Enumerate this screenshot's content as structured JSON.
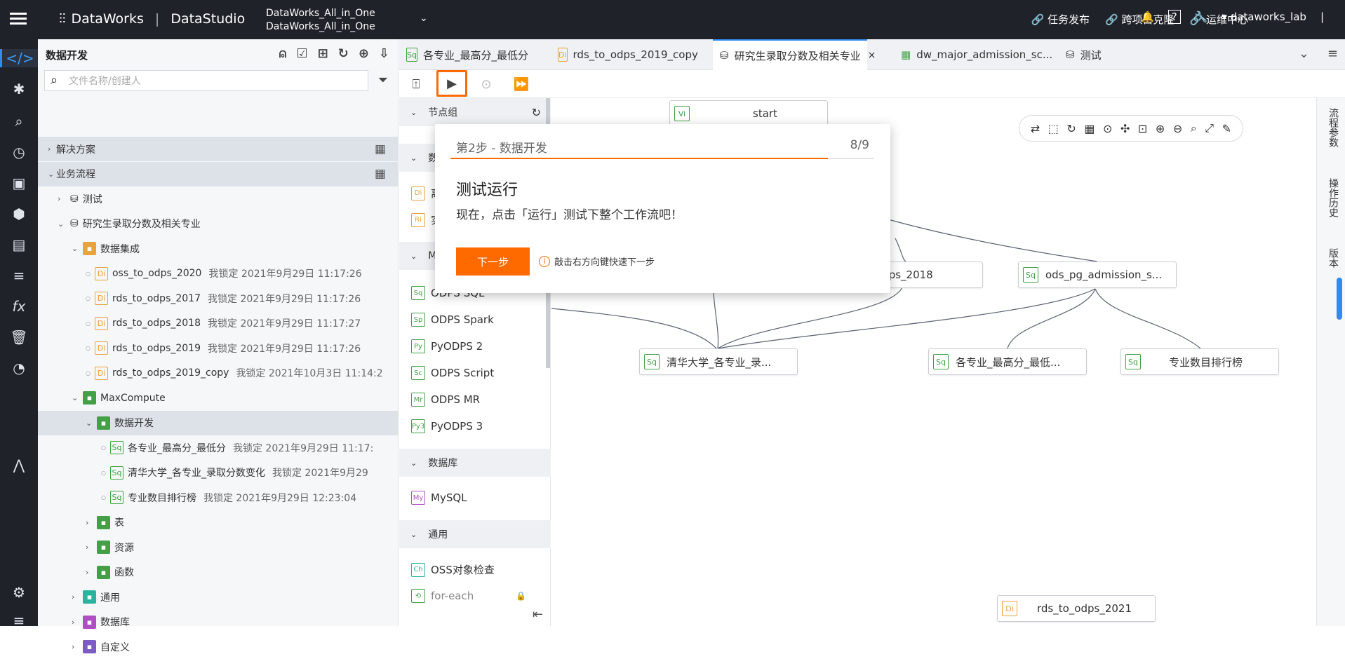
{
  "topbar": {
    "product": "DataWorks",
    "module": "DataStudio",
    "workspace_line1": "DataWorks_All_in_One",
    "workspace_line2": "DataWorks_All_in_One",
    "links": [
      "任务发布",
      "跨项目克隆",
      "运维中心"
    ],
    "help": "?",
    "user": "dataworks_lab"
  },
  "sidebar": {
    "title": "数据开发",
    "search_placeholder": "文件名称/创建人",
    "tree": [
      {
        "label": "解决方案",
        "level": 0,
        "caret": "›",
        "grid": true
      },
      {
        "label": "业务流程",
        "level": 0,
        "caret": "⌄",
        "grid": true
      },
      {
        "label": "测试",
        "level": 1,
        "caret": "›"
      },
      {
        "label": "研究生录取分数及相关专业",
        "level": 1,
        "caret": "⌄"
      },
      {
        "label": "数据集成",
        "level": 2,
        "caret": "⌄"
      },
      {
        "label": "oss_to_odps_2020",
        "meta": "我锁定  2021年9月29日 11:17:26",
        "level": 3,
        "icon": "Di"
      },
      {
        "label": "rds_to_odps_2017",
        "meta": "我锁定  2021年9月29日 11:17:26",
        "level": 3,
        "icon": "Di"
      },
      {
        "label": "rds_to_odps_2018",
        "meta": "我锁定  2021年9月29日 11:17:27",
        "level": 3,
        "icon": "Di"
      },
      {
        "label": "rds_to_odps_2019",
        "meta": "我锁定  2021年9月29日 11:17:26",
        "level": 3,
        "icon": "Di"
      },
      {
        "label": "rds_to_odps_2019_copy",
        "meta": "我锁定  2021年10月3日 11:14:2",
        "level": 3,
        "icon": "Di"
      },
      {
        "label": "MaxCompute",
        "level": 2,
        "caret": "⌄"
      },
      {
        "label": "数据开发",
        "level": 3,
        "caret": "⌄"
      },
      {
        "label": "各专业_最高分_最低分",
        "meta": "我锁定  2021年9月29日 11:17:",
        "level": 4,
        "icon": "Sq"
      },
      {
        "label": "清华大学_各专业_录取分数变化",
        "meta": "我锁定  2021年9月29",
        "level": 4,
        "icon": "Sq"
      },
      {
        "label": "专业数目排行榜",
        "meta": "我锁定  2021年9月29日 12:23:04",
        "level": 4,
        "icon": "Sq"
      },
      {
        "label": "表",
        "level": 3,
        "caret": "›"
      },
      {
        "label": "资源",
        "level": 3,
        "caret": "›"
      },
      {
        "label": "函数",
        "level": 3,
        "caret": "›"
      },
      {
        "label": "通用",
        "level": 2,
        "caret": "›"
      },
      {
        "label": "数据库",
        "level": 2,
        "caret": "›"
      },
      {
        "label": "自定义",
        "level": 2,
        "caret": "›"
      }
    ]
  },
  "tabs": [
    {
      "label": "各专业_最高分_最低分",
      "icon": "Sq"
    },
    {
      "label": "rds_to_odps_2019_copy",
      "icon": "Di"
    },
    {
      "label": "研究生录取分数及相关专业",
      "icon": "flow",
      "close": "×"
    },
    {
      "label": "dw_major_admission_sc...",
      "icon": "table"
    },
    {
      "label": "测试",
      "icon": "flow"
    }
  ],
  "node_panel": {
    "sections": [
      "节点组",
      "数",
      "M",
      "数据库",
      "通用"
    ],
    "maxcompute_nodes": [
      "ODPS SQL",
      "ODPS Spark",
      "PyODPS 2",
      "ODPS Script",
      "ODPS MR",
      "PyODPS 3"
    ],
    "maxcompute_icons": [
      "Sq",
      "Sp",
      "Py",
      "Sc",
      "Mr",
      "Py3"
    ],
    "db_nodes": [
      "MySQL"
    ],
    "general_nodes": [
      "OSS对象检查",
      "for-each"
    ],
    "partial_labels": [
      "离",
      "实"
    ],
    "partial_icons": [
      "Di",
      "Ri"
    ]
  },
  "canvas": {
    "nodes": [
      {
        "label": "start",
        "icon": "Vi"
      },
      {
        "label": "odps_2018",
        "icon": ""
      },
      {
        "label": "ods_pg_admission_s...",
        "icon": "Sq"
      },
      {
        "label": "清华大学_各专业_录...",
        "icon": "Sq"
      },
      {
        "label": "各专业_最高分_最低...",
        "icon": "Sq"
      },
      {
        "label": "专业数目排行榜",
        "icon": "Sq"
      },
      {
        "label": "rds_to_odps_2021",
        "icon": "Di"
      }
    ]
  },
  "right_panel": [
    "流程参数",
    "操作历史",
    "版本"
  ],
  "guide": {
    "step": "第2步 - 数据开发",
    "counter": "8/9",
    "progress": 0.89,
    "title": "测试运行",
    "description": "现在，点击「运行」测试下整个工作流吧！",
    "next_label": "下一步",
    "hint": "敲击右方向键快速下一步"
  }
}
